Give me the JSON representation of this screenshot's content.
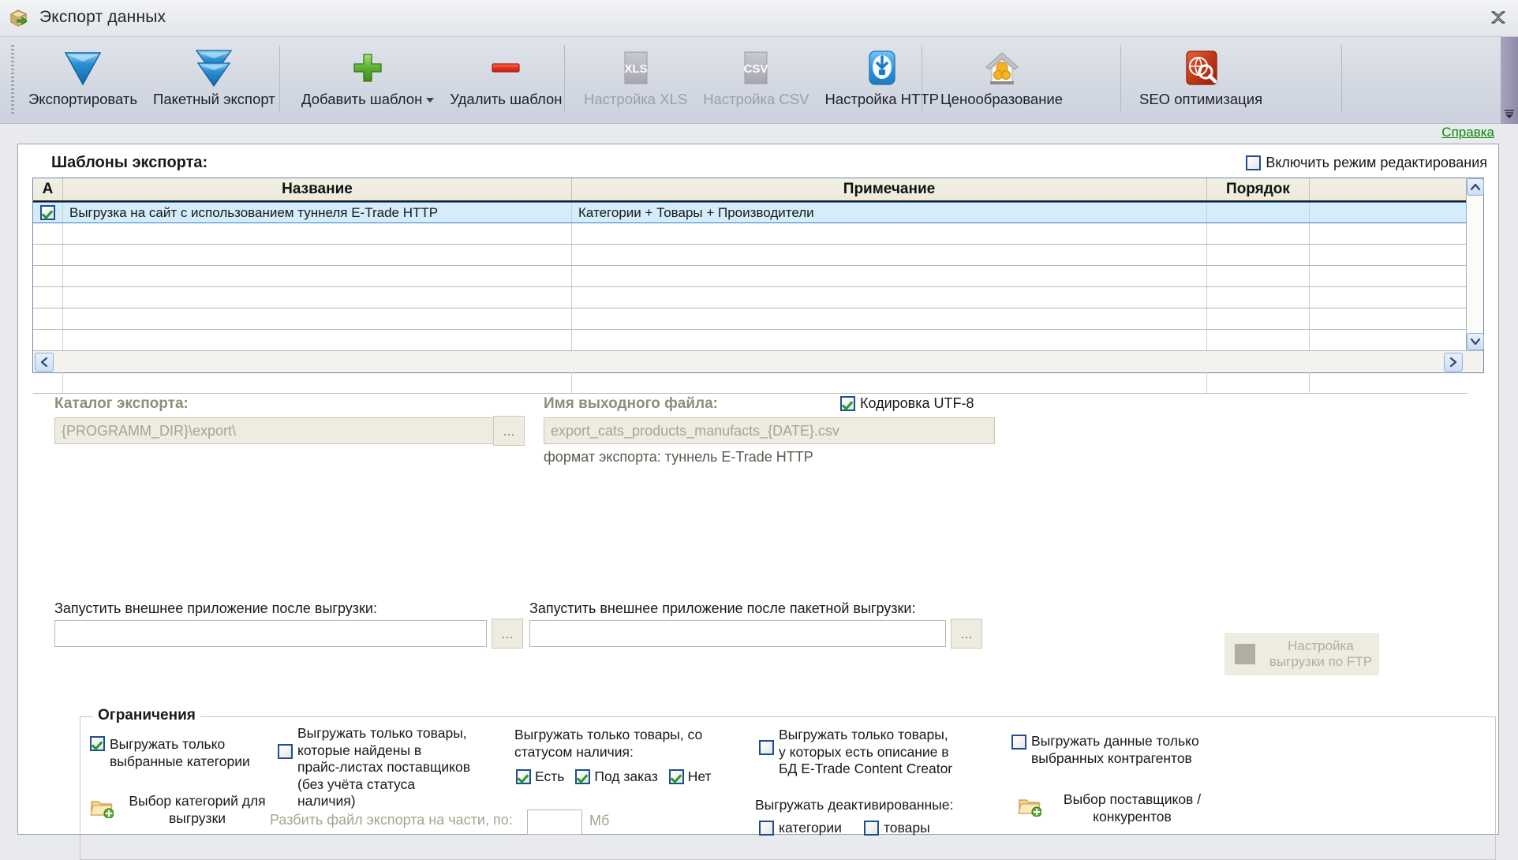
{
  "window": {
    "title": "Экспорт данных",
    "app_icon": "package-export-icon",
    "close_icon": "close-icon"
  },
  "ribbon": {
    "groups": [
      {
        "buttons": [
          {
            "label": "Экспортировать",
            "icon": "blue-down-arrow-icon",
            "disabled": false,
            "dropdown": false
          },
          {
            "label": "Пакетный экспорт",
            "icon": "blue-double-down-arrow-icon",
            "disabled": false,
            "dropdown": false
          }
        ]
      },
      {
        "buttons": [
          {
            "label": "Добавить шаблон",
            "icon": "green-plus-icon",
            "disabled": false,
            "dropdown": true
          },
          {
            "label": "Удалить шаблон",
            "icon": "red-minus-icon",
            "disabled": false,
            "dropdown": false
          }
        ]
      },
      {
        "buttons": [
          {
            "label": "Настройка XLS",
            "icon": "xls-icon",
            "disabled": true,
            "dropdown": false,
            "badge": "XLS"
          },
          {
            "label": "Настройка CSV",
            "icon": "csv-icon",
            "disabled": true,
            "dropdown": false,
            "badge": "CSV"
          },
          {
            "label": "Настройка HTTP",
            "icon": "http-download-icon",
            "disabled": false,
            "dropdown": false
          }
        ]
      },
      {
        "buttons": [
          {
            "label": "Ценообразование",
            "icon": "house-money-icon",
            "disabled": false,
            "dropdown": false
          }
        ]
      },
      {
        "buttons": [
          {
            "label": "SEO оптимизация",
            "icon": "seo-globe-magnifier-icon",
            "disabled": false,
            "dropdown": false
          }
        ]
      }
    ]
  },
  "help_link": "Справка",
  "templates": {
    "section_label": "Шаблоны экспорта:",
    "edit_mode": {
      "label": "Включить режим редактирования",
      "checked": false
    },
    "columns": [
      "А",
      "Название",
      "Примечание",
      "Порядок",
      ""
    ],
    "rows": [
      {
        "checked": true,
        "name": "Выгрузка на сайт с использованием туннеля E-Trade HTTP",
        "note": "Категории + Товары + Производители",
        "order": "",
        "selected": true
      }
    ],
    "empty_row_count": 8,
    "scroll": {
      "up_icon": "chevron-up-icon",
      "down_icon": "chevron-down-icon",
      "left_icon": "chevron-left-icon",
      "right_icon": "chevron-right-icon"
    }
  },
  "fields": {
    "export_dir_label": "Каталог экспорта:",
    "export_dir_value": "{PROGRAMM_DIR}\\export\\",
    "export_dir_browse": "...",
    "output_file_label": "Имя выходного файла:",
    "output_file_value": "export_cats_products_manufacts_{DATE}.csv",
    "encoding_utf8": {
      "label": "Кодировка UTF-8",
      "checked": true
    },
    "format_note": "формат экспорта: туннель E-Trade HTTP",
    "ftp_button": {
      "line1": "Настройка",
      "line2": "выгрузки по FTP",
      "disabled": true
    }
  },
  "limits": {
    "title": "Ограничения",
    "only_selected_categories": {
      "label": "Выгружать только\nвыбранные категории",
      "checked": true
    },
    "choose_categories_button": {
      "label": "Выбор категорий для\nвыгрузки",
      "icon": "folder-add-icon"
    },
    "only_in_pricelists": {
      "label": "Выгружать только товары,\nкоторые найдены в\nпрайс-листах поставщиков\n(без учёта статуса наличия)",
      "checked": false
    },
    "split_file": {
      "label": "Разбить файл экспорта на части, по:",
      "value": "",
      "unit": "Мб"
    },
    "availability_label": "Выгружать только товары, со\nстатусом наличия:",
    "availability_options": [
      {
        "label": "Есть",
        "checked": true
      },
      {
        "label": "Под заказ",
        "checked": true
      },
      {
        "label": "Нет",
        "checked": true
      }
    ],
    "only_with_description": {
      "label": "Выгружать только товары,\nу которых есть описание в\nБД E-Trade Content Creator",
      "checked": false
    },
    "deactivated_label": "Выгружать деактивированные:",
    "deactivated_options": [
      {
        "label": "категории",
        "checked": false
      },
      {
        "label": "товары",
        "checked": false
      }
    ],
    "only_selected_counterparties": {
      "label": "Выгружать данные только\nвыбранных контрагентов",
      "checked": false
    },
    "choose_suppliers_button": {
      "label": "Выбор поставщиков /\nконкурентов",
      "icon": "folder-add-icon"
    }
  },
  "bottom": {
    "after_export_label": "Запустить внешнее приложение после выгрузки:",
    "after_export_value": "",
    "after_export_browse": "...",
    "after_batch_label": "Запустить внешнее приложение после пакетной выгрузки:",
    "after_batch_value": "",
    "after_batch_browse": "..."
  },
  "colors": {
    "accent_blue": "#3f7fbf",
    "row_selected": "#d4ecfb",
    "help_green": "#0a8a0a",
    "check_green": "#1f9d2b",
    "seo_red": "#c0351c"
  }
}
